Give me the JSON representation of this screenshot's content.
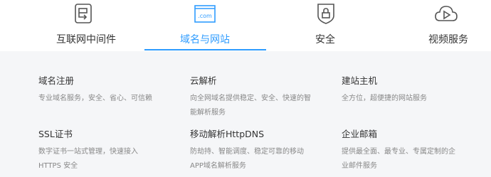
{
  "tabs": [
    {
      "label": "互联网中间件",
      "icon": "middleware-icon"
    },
    {
      "label": "域名与网站",
      "icon": "domain-com-icon"
    },
    {
      "label": "安全",
      "icon": "shield-lock-icon"
    },
    {
      "label": "视频服务",
      "icon": "cloud-play-icon"
    }
  ],
  "active_tab": 1,
  "accent_color": "#2f9cff",
  "products": [
    {
      "title": "域名注册",
      "desc": "专业域名服务，安全、省心、可信赖"
    },
    {
      "title": "云解析",
      "desc": "向全网域名提供稳定、安全、快速的智能解析服务"
    },
    {
      "title": "建站主机",
      "desc": "全方位，超便捷的网站服务"
    },
    {
      "title": "SSL证书",
      "desc": "数字证书一站式管理，快速接入HTTPS 安全"
    },
    {
      "title": "移动解析HttpDNS",
      "desc": "防劫持、智能调度、稳定可靠的移动APP域名解析服务"
    },
    {
      "title": "企业邮箱",
      "desc": "提供最全面、最专业、专属定制的企业邮件服务"
    }
  ]
}
